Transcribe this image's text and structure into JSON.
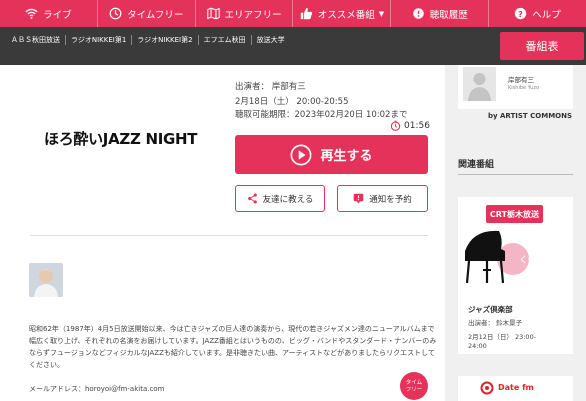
{
  "nav": {
    "items": [
      {
        "label": "ライブ",
        "icon": "wifi-icon"
      },
      {
        "label": "タイムフリー",
        "icon": "clock-icon"
      },
      {
        "label": "エリアフリー",
        "icon": "map-icon"
      },
      {
        "label": "オススメ番組",
        "icon": "thumbs-up-icon"
      },
      {
        "label": "聴取履歴",
        "icon": "history-icon"
      },
      {
        "label": "ヘルプ",
        "icon": "question-icon"
      }
    ]
  },
  "stations": [
    "ＡＢＳ秋田放送",
    "ラジオNIKKEI第1",
    "ラジオNIKKEI第2",
    "エフエム秋田",
    "放送大学"
  ],
  "schedule_button": "番組表",
  "program": {
    "title": "ほろ酔いJAZZ NIGHT",
    "performer": "出演者： 岸部有三",
    "airtime": "2月18日（土） 20:00-20:55",
    "deadline": "聴取可能期限：2023年02月20日 10:02まで",
    "remaining": "01:56",
    "play_label": "再生する",
    "share_label": "友達に教える",
    "notify_label": "通知を予約",
    "description": "昭和62年（1987年）4月5日放送開始以来、今は亡きジャズの巨人達の演奏から、現代の若きジャズメン達のニューアルバムまで幅広く取り上げ、それぞれの名演をお届けしています。JAZZ番組とはいうものの、ビッグ・バンドやスタンダード・ナンバーのみならずフュージョンなどフィジカルなJAZZも紹介しています。是非聴きたい曲、アーティストなどがありましたらリクエストしてください。",
    "email": "メールアドレス：horoyoi@fm-akita.com",
    "timefree_badge": "タイム\nフリー"
  },
  "sidebar": {
    "performer_name": "岸部有三",
    "performer_roman": "Kishibe Yuzo",
    "by_artist": "by ARTIST COMMONS",
    "related_title": "関連番組",
    "related": [
      {
        "logo": "CRT栃木放送",
        "name": "ジャズ倶楽部",
        "performer": "出演者： 鈴木景子",
        "date_line1": "2月12日（日） 23:00-",
        "date_line2": "24:00"
      },
      {
        "logo": "Date fm"
      }
    ]
  },
  "colors": {
    "accent": "#e5325b",
    "station_bar": "#3a3a3a",
    "background": "#f0f0f0"
  }
}
